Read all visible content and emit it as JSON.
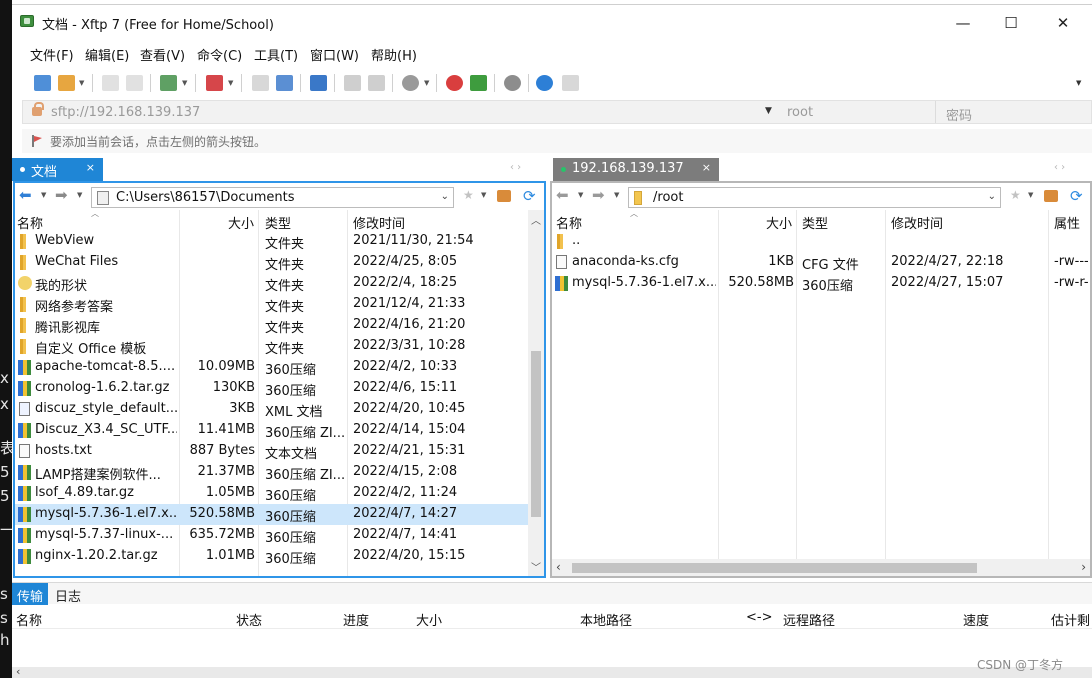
{
  "window": {
    "title": "文档 - Xftp 7 (Free for Home/School)",
    "minimize": "—",
    "maximize": "☐",
    "close": "✕"
  },
  "desktop_strip_chars": [
    "x",
    "x",
    "表",
    "5",
    "5",
    "一",
    "s",
    "s",
    "h"
  ],
  "menu": [
    "文件(F)",
    "编辑(E)",
    "查看(V)",
    "命令(C)",
    "工具(T)",
    "窗口(W)",
    "帮助(H)"
  ],
  "toolbar_icons": [
    "new-session-icon",
    "open-folder-icon",
    "copy-icon",
    "paste-icon",
    "new-transfer-icon",
    "terminal-icon",
    "new-file-icon",
    "new-folder-icon",
    "sync-icon",
    "copy-path-icon",
    "compare-icon",
    "status-icon",
    "xshell-icon",
    "xftp-icon",
    "gear-icon",
    "help-icon",
    "chat-icon"
  ],
  "address": {
    "value": "sftp://192.168.139.137",
    "user_placeholder": "root",
    "password_placeholder": "密码"
  },
  "hint": "要添加当前会话，点击左侧的箭头按钮。",
  "left_tab": {
    "label": "文档",
    "close": "×"
  },
  "right_tab": {
    "label": "192.168.139.137",
    "close": "×"
  },
  "tab_arrows": "‹ ›",
  "left_pane": {
    "path": "C:\\Users\\86157\\Documents",
    "headers": {
      "name": "名称",
      "size": "大小",
      "type": "类型",
      "modified": "修改时间"
    },
    "rows": [
      {
        "icon": "folder",
        "name": "WebView",
        "size": "",
        "type": "文件夹",
        "modified": "2021/11/30, 21:54"
      },
      {
        "icon": "folder",
        "name": "WeChat Files",
        "size": "",
        "type": "文件夹",
        "modified": "2022/4/25, 8:05"
      },
      {
        "icon": "mine",
        "name": "我的形状",
        "size": "",
        "type": "文件夹",
        "modified": "2022/2/4, 18:25"
      },
      {
        "icon": "folder",
        "name": "网络参考答案",
        "size": "",
        "type": "文件夹",
        "modified": "2021/12/4, 21:33"
      },
      {
        "icon": "folder",
        "name": "腾讯影视库",
        "size": "",
        "type": "文件夹",
        "modified": "2022/4/16, 21:20"
      },
      {
        "icon": "folder",
        "name": "自定义 Office 模板",
        "size": "",
        "type": "文件夹",
        "modified": "2022/3/31, 10:28"
      },
      {
        "icon": "archive",
        "name": "apache-tomcat-8.5....",
        "size": "10.09MB",
        "type": "360压缩",
        "modified": "2022/4/2, 10:33"
      },
      {
        "icon": "archive",
        "name": "cronolog-1.6.2.tar.gz",
        "size": "130KB",
        "type": "360压缩",
        "modified": "2022/4/6, 15:11"
      },
      {
        "icon": "xml",
        "name": "discuz_style_default...",
        "size": "3KB",
        "type": "XML 文档",
        "modified": "2022/4/20, 10:45"
      },
      {
        "icon": "archive",
        "name": "Discuz_X3.4_SC_UTF...",
        "size": "11.41MB",
        "type": "360压缩 ZI...",
        "modified": "2022/4/14, 15:04"
      },
      {
        "icon": "text",
        "name": "hosts.txt",
        "size": "887 Bytes",
        "type": "文本文档",
        "modified": "2022/4/21, 15:31"
      },
      {
        "icon": "archive",
        "name": "LAMP搭建案例软件...",
        "size": "21.37MB",
        "type": "360压缩 ZI...",
        "modified": "2022/4/15, 2:08"
      },
      {
        "icon": "archive",
        "name": "lsof_4.89.tar.gz",
        "size": "1.05MB",
        "type": "360压缩",
        "modified": "2022/4/2, 11:24"
      },
      {
        "icon": "archive",
        "name": "mysql-5.7.36-1.el7.x...",
        "size": "520.58MB",
        "type": "360压缩",
        "modified": "2022/4/7, 14:27",
        "selected": true
      },
      {
        "icon": "archive",
        "name": "mysql-5.7.37-linux-...",
        "size": "635.72MB",
        "type": "360压缩",
        "modified": "2022/4/7, 14:41"
      },
      {
        "icon": "archive",
        "name": "nginx-1.20.2.tar.gz",
        "size": "1.01MB",
        "type": "360压缩",
        "modified": "2022/4/20, 15:15"
      }
    ]
  },
  "right_pane": {
    "path": "/root",
    "headers": {
      "name": "名称",
      "size": "大小",
      "type": "类型",
      "modified": "修改时间",
      "attr": "属性"
    },
    "rows": [
      {
        "icon": "folder",
        "name": "..",
        "size": "",
        "type": "",
        "modified": "",
        "attr": ""
      },
      {
        "icon": "cfg",
        "name": "anaconda-ks.cfg",
        "size": "1KB",
        "type": "CFG 文件",
        "modified": "2022/4/27, 22:18",
        "attr": "-rw---"
      },
      {
        "icon": "archive",
        "name": "mysql-5.7.36-1.el7.x...",
        "size": "520.58MB",
        "type": "360压缩",
        "modified": "2022/4/27, 15:07",
        "attr": "-rw-r-"
      }
    ]
  },
  "bottom_tabs": {
    "transfer": "传输",
    "log": "日志"
  },
  "transfer_headers": [
    "名称",
    "状态",
    "进度",
    "大小",
    "本地路径",
    "<->",
    "远程路径",
    "速度",
    "估计剩"
  ],
  "watermark": "CSDN @丁冬方"
}
